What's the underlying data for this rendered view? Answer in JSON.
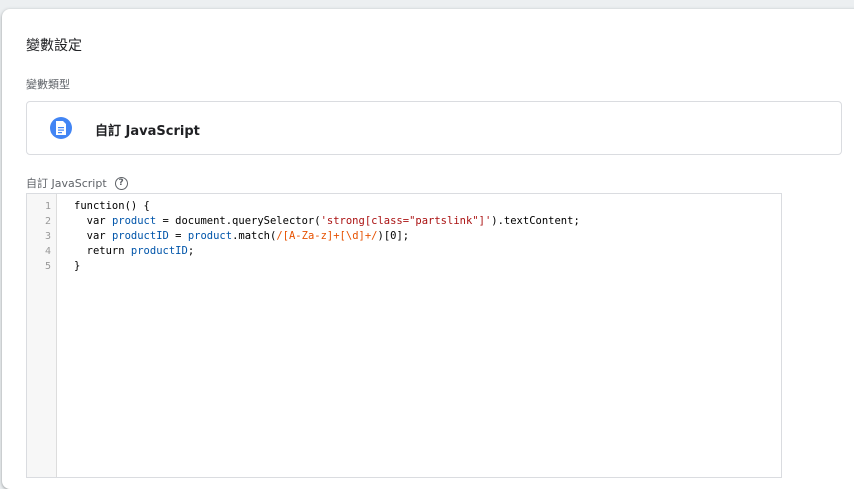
{
  "section_title": "變數設定",
  "var_type_label": "變數類型",
  "var_type_name": "自訂 JavaScript",
  "editor_label": "自訂 JavaScript",
  "help_icon": "?",
  "line_numbers": [
    "1",
    "2",
    "3",
    "4",
    "5"
  ],
  "code": {
    "l1_a": "function() {",
    "l2_a": "  var ",
    "l2_b": "product",
    "l2_c": " = document.querySelector(",
    "l2_d": "'strong[class=\"partslink\"]'",
    "l2_e": ").textContent;",
    "l3_a": "  var ",
    "l3_b": "productID",
    "l3_c": " = ",
    "l3_d": "product",
    "l3_e": ".match(",
    "l3_f": "/[A-Za-z]+[\\d]+/",
    "l3_g": ")[",
    "l3_h": "0",
    "l3_i": "];",
    "l4_a": "  return ",
    "l4_b": "productID",
    "l4_c": ";",
    "l5_a": "}"
  },
  "colors": {
    "icon_blue": "#4285f4",
    "keyword_var": "#0055aa",
    "string": "#aa1111",
    "regex": "#e65100"
  },
  "icons": {
    "type_icon": "document-icon",
    "help": "help-circle-icon"
  }
}
